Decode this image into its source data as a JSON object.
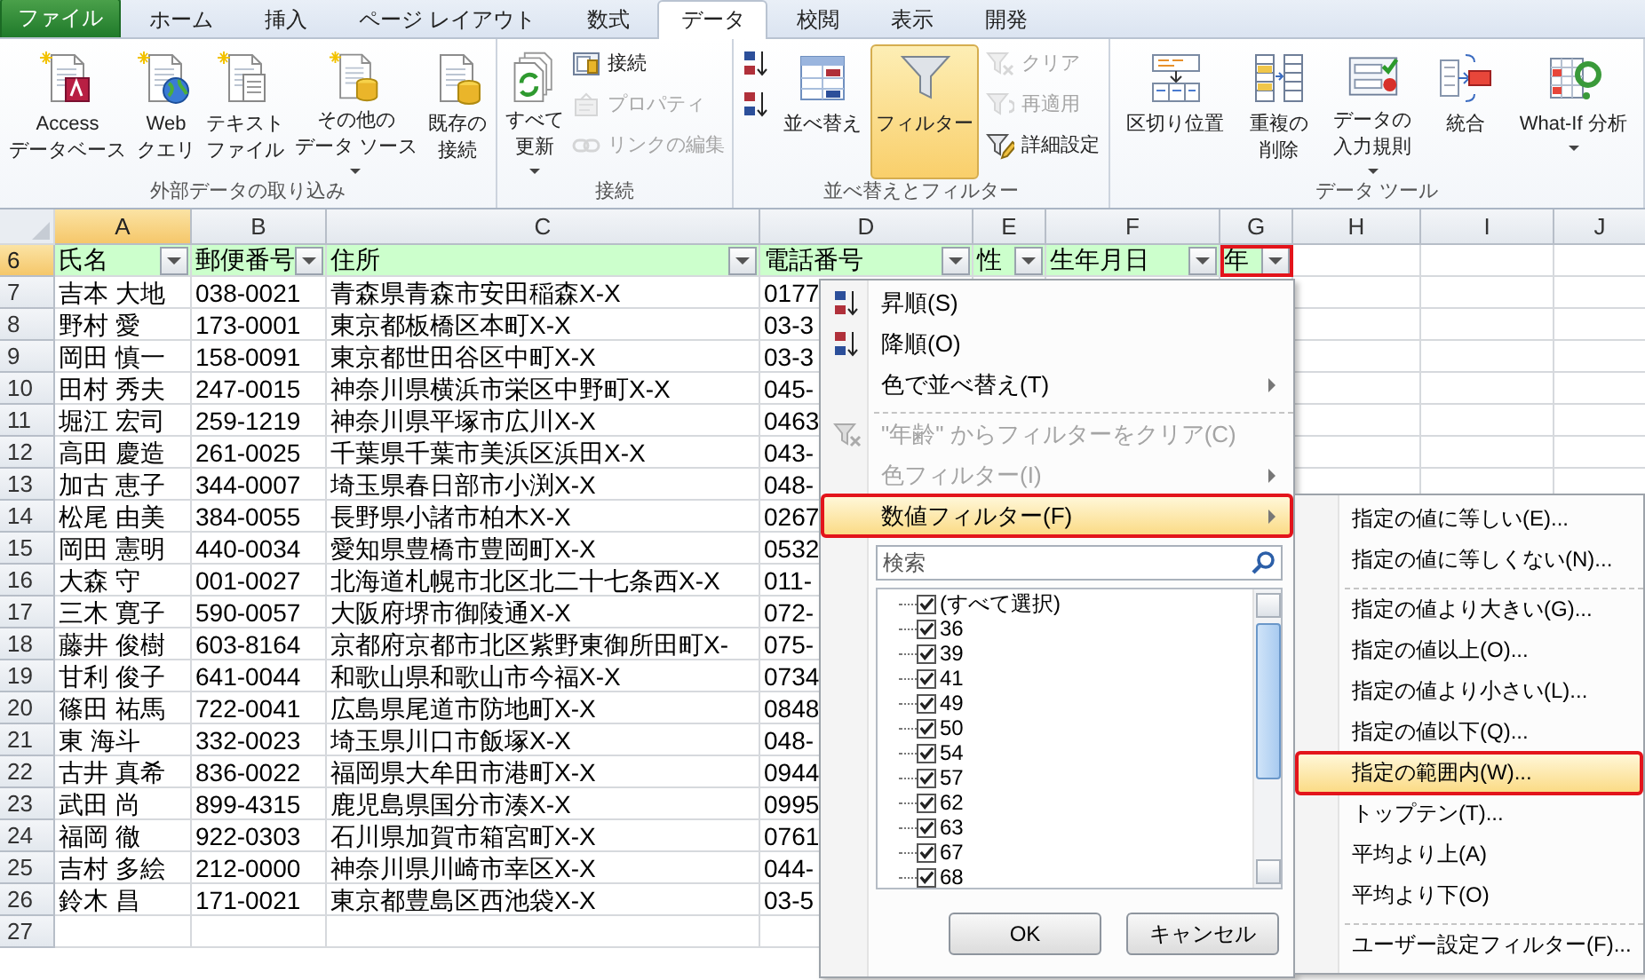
{
  "ribbon": {
    "tabs": [
      {
        "label": "ファイル",
        "kind": "file",
        "selected": false
      },
      {
        "label": "ホーム",
        "kind": "tab",
        "selected": false
      },
      {
        "label": "挿入",
        "kind": "tab",
        "selected": false
      },
      {
        "label": "ページ レイアウト",
        "kind": "tab",
        "selected": false
      },
      {
        "label": "数式",
        "kind": "tab",
        "selected": false
      },
      {
        "label": "データ",
        "kind": "tab",
        "selected": true
      },
      {
        "label": "校閲",
        "kind": "tab",
        "selected": false
      },
      {
        "label": "表示",
        "kind": "tab",
        "selected": false
      },
      {
        "label": "開発",
        "kind": "tab",
        "selected": false
      }
    ],
    "groups": [
      {
        "label": "外部データの取り込み",
        "items": [
          {
            "kind": "large",
            "lines": [
              "Access",
              "データベース"
            ],
            "pressed": false,
            "dropdown": false
          },
          {
            "kind": "large",
            "lines": [
              "Web",
              "クエリ"
            ],
            "pressed": false,
            "dropdown": false
          },
          {
            "kind": "large",
            "lines": [
              "テキスト",
              "ファイル"
            ],
            "pressed": false,
            "dropdown": false
          },
          {
            "kind": "large",
            "lines": [
              "その他の",
              "データ ソース"
            ],
            "pressed": false,
            "dropdown": true
          },
          {
            "kind": "large",
            "lines": [
              "既存の",
              "接続"
            ],
            "pressed": false,
            "dropdown": false
          }
        ]
      },
      {
        "label": "接続",
        "items": [
          {
            "kind": "large",
            "lines": [
              "すべて",
              "更新"
            ],
            "pressed": false,
            "dropdown": true
          },
          {
            "kind": "stack",
            "items": [
              {
                "label": "接続",
                "disabled": false
              },
              {
                "label": "プロパティ",
                "disabled": true
              },
              {
                "label": "リンクの編集",
                "disabled": true
              }
            ]
          }
        ]
      },
      {
        "label": "並べ替えとフィルター",
        "items": [
          {
            "kind": "stack",
            "items": [
              {
                "disabled": false
              },
              {
                "disabled": false
              }
            ]
          },
          {
            "kind": "large",
            "lines": [
              "並べ替え"
            ],
            "pressed": false,
            "dropdown": false
          },
          {
            "kind": "large",
            "lines": [
              "フィルター"
            ],
            "pressed": true,
            "dropdown": false
          },
          {
            "kind": "stack",
            "items": [
              {
                "label": "クリア",
                "disabled": true
              },
              {
                "label": "再適用",
                "disabled": true
              },
              {
                "label": "詳細設定",
                "disabled": false
              }
            ]
          }
        ]
      },
      {
        "label": "データ ツール",
        "items": [
          {
            "kind": "large",
            "lines": [
              "区切り位置"
            ],
            "pressed": false,
            "dropdown": false
          },
          {
            "kind": "large",
            "lines": [
              "重複の",
              "削除"
            ],
            "pressed": false,
            "dropdown": false
          },
          {
            "kind": "large",
            "lines": [
              "データの",
              "入力規則"
            ],
            "pressed": false,
            "dropdown": true
          },
          {
            "kind": "large",
            "lines": [
              "統合"
            ],
            "pressed": false,
            "dropdown": false
          },
          {
            "kind": "large",
            "lines": [
              "What-If 分析"
            ],
            "pressed": false,
            "dropdown": true
          }
        ]
      }
    ]
  },
  "sheet": {
    "columns": [
      {
        "letter": "A",
        "selected": true
      },
      {
        "letter": "B",
        "selected": false
      },
      {
        "letter": "C",
        "selected": false
      },
      {
        "letter": "D",
        "selected": false
      },
      {
        "letter": "E",
        "selected": false
      },
      {
        "letter": "F",
        "selected": false
      },
      {
        "letter": "G",
        "selected": false
      },
      {
        "letter": "H",
        "selected": false
      },
      {
        "letter": "I",
        "selected": false
      },
      {
        "letter": "J",
        "selected": false
      }
    ],
    "rows": [
      {
        "number": "6",
        "kind": "header",
        "selected": true,
        "cells": [
          {
            "text": "氏名",
            "filter": true
          },
          {
            "text": "郵便番号",
            "filter": true
          },
          {
            "text": "住所",
            "filter": true
          },
          {
            "text": "電話番号",
            "filter": true
          },
          {
            "text": "性",
            "filter": true
          },
          {
            "text": "生年月日",
            "filter": true
          },
          {
            "text": "年",
            "filter": true,
            "callout": true
          }
        ]
      },
      {
        "number": "7",
        "kind": "data",
        "selected": false,
        "cells": [
          "吉本 大地",
          "038-0021",
          "青森県青森市安田稲森X-X",
          "0177"
        ]
      },
      {
        "number": "8",
        "kind": "data",
        "selected": false,
        "cells": [
          "野村 愛",
          "173-0001",
          "東京都板橋区本町X-X",
          "03-3"
        ]
      },
      {
        "number": "9",
        "kind": "data",
        "selected": false,
        "cells": [
          "岡田 慎一",
          "158-0091",
          "東京都世田谷区中町X-X",
          "03-3"
        ]
      },
      {
        "number": "10",
        "kind": "data",
        "selected": false,
        "cells": [
          "田村 秀夫",
          "247-0015",
          "神奈川県横浜市栄区中野町X-X",
          "045-"
        ]
      },
      {
        "number": "11",
        "kind": "data",
        "selected": false,
        "cells": [
          "堀江 宏司",
          "259-1219",
          "神奈川県平塚市広川X-X",
          "0463"
        ]
      },
      {
        "number": "12",
        "kind": "data",
        "selected": false,
        "cells": [
          "高田 慶造",
          "261-0025",
          "千葉県千葉市美浜区浜田X-X",
          "043-"
        ]
      },
      {
        "number": "13",
        "kind": "data",
        "selected": false,
        "cells": [
          "加古 恵子",
          "344-0007",
          "埼玉県春日部市小渕X-X",
          "048-"
        ]
      },
      {
        "number": "14",
        "kind": "data",
        "selected": false,
        "cells": [
          "松尾 由美",
          "384-0055",
          "長野県小諸市柏木X-X",
          "0267"
        ]
      },
      {
        "number": "15",
        "kind": "data",
        "selected": false,
        "cells": [
          "岡田 憲明",
          "440-0034",
          "愛知県豊橋市豊岡町X-X",
          "0532"
        ]
      },
      {
        "number": "16",
        "kind": "data",
        "selected": false,
        "cells": [
          "大森 守",
          "001-0027",
          "北海道札幌市北区北二十七条西X-X",
          "011-"
        ]
      },
      {
        "number": "17",
        "kind": "data",
        "selected": false,
        "cells": [
          "三木 寛子",
          "590-0057",
          "大阪府堺市御陵通X-X",
          "072-"
        ]
      },
      {
        "number": "18",
        "kind": "data",
        "selected": false,
        "cells": [
          "藤井 俊樹",
          "603-8164",
          "京都府京都市北区紫野東御所田町X-",
          "075-"
        ]
      },
      {
        "number": "19",
        "kind": "data",
        "selected": false,
        "cells": [
          "甘利 俊子",
          "641-0044",
          "和歌山県和歌山市今福X-X",
          "0734"
        ]
      },
      {
        "number": "20",
        "kind": "data",
        "selected": false,
        "cells": [
          "篠田 祐馬",
          "722-0041",
          "広島県尾道市防地町X-X",
          "0848"
        ]
      },
      {
        "number": "21",
        "kind": "data",
        "selected": false,
        "cells": [
          "東 海斗",
          "332-0023",
          "埼玉県川口市飯塚X-X",
          "048-"
        ]
      },
      {
        "number": "22",
        "kind": "data",
        "selected": false,
        "cells": [
          "古井 真希",
          "836-0022",
          "福岡県大牟田市港町X-X",
          "0944"
        ]
      },
      {
        "number": "23",
        "kind": "data",
        "selected": false,
        "cells": [
          "武田 尚",
          "899-4315",
          "鹿児島県国分市湊X-X",
          "0995"
        ]
      },
      {
        "number": "24",
        "kind": "data",
        "selected": false,
        "cells": [
          "福岡 徹",
          "922-0303",
          "石川県加賀市箱宮町X-X",
          "0761"
        ]
      },
      {
        "number": "25",
        "kind": "data",
        "selected": false,
        "cells": [
          "吉村 多絵",
          "212-0000",
          "神奈川県川崎市幸区X-X",
          "044-"
        ]
      },
      {
        "number": "26",
        "kind": "data",
        "selected": false,
        "cells": [
          "鈴木 昌",
          "171-0021",
          "東京都豊島区西池袋X-X",
          "03-5"
        ]
      },
      {
        "number": "27",
        "selected": false,
        "cells": []
      }
    ]
  },
  "filter_menu": {
    "items": [
      {
        "kind": "command",
        "label": "昇順(S)",
        "disabled": false,
        "hovered": false,
        "callout": false
      },
      {
        "kind": "command",
        "label": "降順(O)",
        "disabled": false,
        "hovered": false,
        "callout": false
      },
      {
        "kind": "submenu",
        "label": "色で並べ替え(T)",
        "disabled": false,
        "hovered": false,
        "callout": false
      },
      {
        "kind": "separator"
      },
      {
        "kind": "command",
        "label": "\"年齢\" からフィルターをクリア(C)",
        "disabled": true,
        "hovered": false,
        "callout": false
      },
      {
        "kind": "submenu",
        "label": "色フィルター(I)",
        "disabled": true,
        "hovered": false,
        "callout": false
      },
      {
        "kind": "submenu",
        "label": "数値フィルター(F)",
        "disabled": false,
        "hovered": true,
        "callout": true
      }
    ],
    "search": {
      "placeholder": "検索"
    },
    "values": [
      {
        "label": "(すべて選択)",
        "checked": true
      },
      {
        "label": "36",
        "checked": true
      },
      {
        "label": "39",
        "checked": true
      },
      {
        "label": "41",
        "checked": true
      },
      {
        "label": "49",
        "checked": true
      },
      {
        "label": "50",
        "checked": true
      },
      {
        "label": "54",
        "checked": true
      },
      {
        "label": "57",
        "checked": true
      },
      {
        "label": "62",
        "checked": true
      },
      {
        "label": "63",
        "checked": true
      },
      {
        "label": "67",
        "checked": true
      },
      {
        "label": "68",
        "checked": true
      }
    ],
    "buttons": [
      "OK",
      "キャンセル"
    ]
  },
  "number_filter_submenu": {
    "items": [
      {
        "kind": "command",
        "label": "指定の値に等しい(E)...",
        "hovered": false,
        "callout": false
      },
      {
        "kind": "command",
        "label": "指定の値に等しくない(N)...",
        "hovered": false,
        "callout": false
      },
      {
        "kind": "separator"
      },
      {
        "kind": "command",
        "label": "指定の値より大きい(G)...",
        "hovered": false,
        "callout": false
      },
      {
        "kind": "command",
        "label": "指定の値以上(O)...",
        "hovered": false,
        "callout": false
      },
      {
        "kind": "command",
        "label": "指定の値より小さい(L)...",
        "hovered": false,
        "callout": false
      },
      {
        "kind": "command",
        "label": "指定の値以下(Q)...",
        "hovered": false,
        "callout": false
      },
      {
        "kind": "command",
        "label": "指定の範囲内(W)...",
        "hovered": true,
        "callout": true
      },
      {
        "kind": "command",
        "label": "トップテン(T)...",
        "hovered": false,
        "callout": false
      },
      {
        "kind": "command",
        "label": "平均より上(A)",
        "hovered": false,
        "callout": false
      },
      {
        "kind": "command",
        "label": "平均より下(O)",
        "hovered": false,
        "callout": false
      },
      {
        "kind": "separator"
      },
      {
        "kind": "command",
        "label": "ユーザー設定フィルター(F)...",
        "hovered": false,
        "callout": false
      }
    ]
  }
}
